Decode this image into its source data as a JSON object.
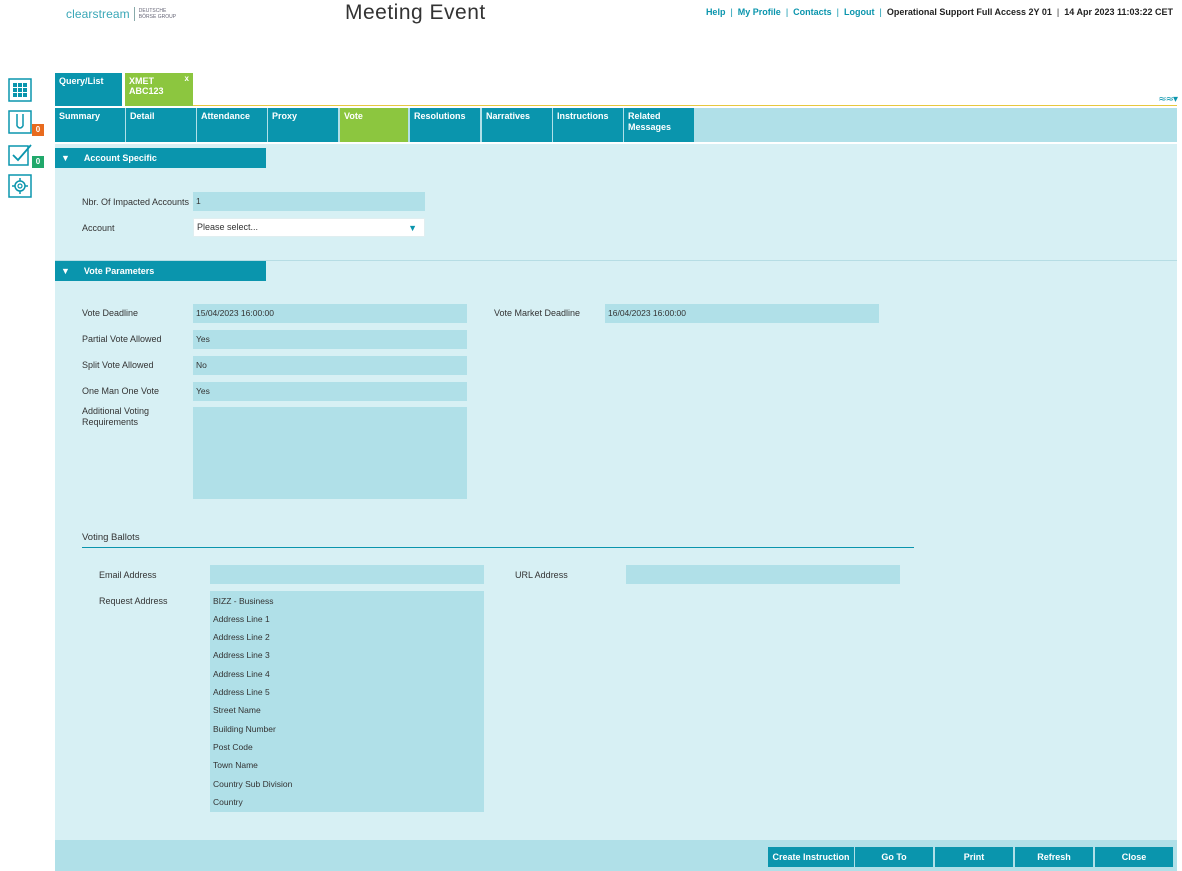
{
  "header": {
    "logo_text": "clearstream",
    "logo_sub": "DEUTSCHE BÖRSE GROUP",
    "page_title": "Meeting Event",
    "links": [
      "Help",
      "My Profile",
      "Contacts",
      "Logout"
    ],
    "user": "Operational Support Full Access 2Y 01",
    "datetime": "14 Apr 2023 11:03:22 CET"
  },
  "rail": {
    "badge_orange": "0",
    "badge_green": "0"
  },
  "doc_tabs": {
    "query": "Query/List",
    "xmet_line1": "XMET",
    "xmet_line2": "ABC123",
    "close": "x",
    "collapse": "≈≈▾"
  },
  "tabs": [
    {
      "label": "Summary"
    },
    {
      "label": "Detail"
    },
    {
      "label": "Attendance"
    },
    {
      "label": "Proxy"
    },
    {
      "label": "Vote"
    },
    {
      "label": "Resolutions"
    },
    {
      "label": "Narratives"
    },
    {
      "label": "Instructions"
    },
    {
      "label": "Related Messages"
    }
  ],
  "account_specific": {
    "title": "Account Specific",
    "impacted_label": "Nbr. Of Impacted Accounts",
    "impacted_value": "1",
    "account_label": "Account",
    "account_placeholder": "Please select..."
  },
  "vote_parameters": {
    "title": "Vote Parameters",
    "vote_deadline_label": "Vote Deadline",
    "vote_deadline_value": "15/04/2023 16:00:00",
    "vote_market_deadline_label": "Vote Market Deadline",
    "vote_market_deadline_value": "16/04/2023 16:00:00",
    "partial_label": "Partial Vote Allowed",
    "partial_value": "Yes",
    "split_label": "Split Vote Allowed",
    "split_value": "No",
    "omov_label": "One Man One Vote",
    "omov_value": "Yes",
    "additional_label": "Additional Voting Requirements",
    "additional_value": ""
  },
  "voting_ballots": {
    "title": "Voting Ballots",
    "email_label": "Email Address",
    "email_value": "",
    "url_label": "URL Address",
    "url_value": "",
    "request_label": "Request Address",
    "request_lines": [
      "BIZZ - Business",
      "Address Line 1",
      "Address Line 2",
      "Address Line 3",
      "Address Line 4",
      "Address Line 5",
      "Street Name",
      "Building Number",
      "Post Code",
      "Town Name",
      "Country Sub Division",
      "Country"
    ]
  },
  "footer": {
    "create_instruction": "Create Instruction",
    "go_to": "Go To",
    "print": "Print",
    "refresh": "Refresh",
    "close": "Close"
  }
}
